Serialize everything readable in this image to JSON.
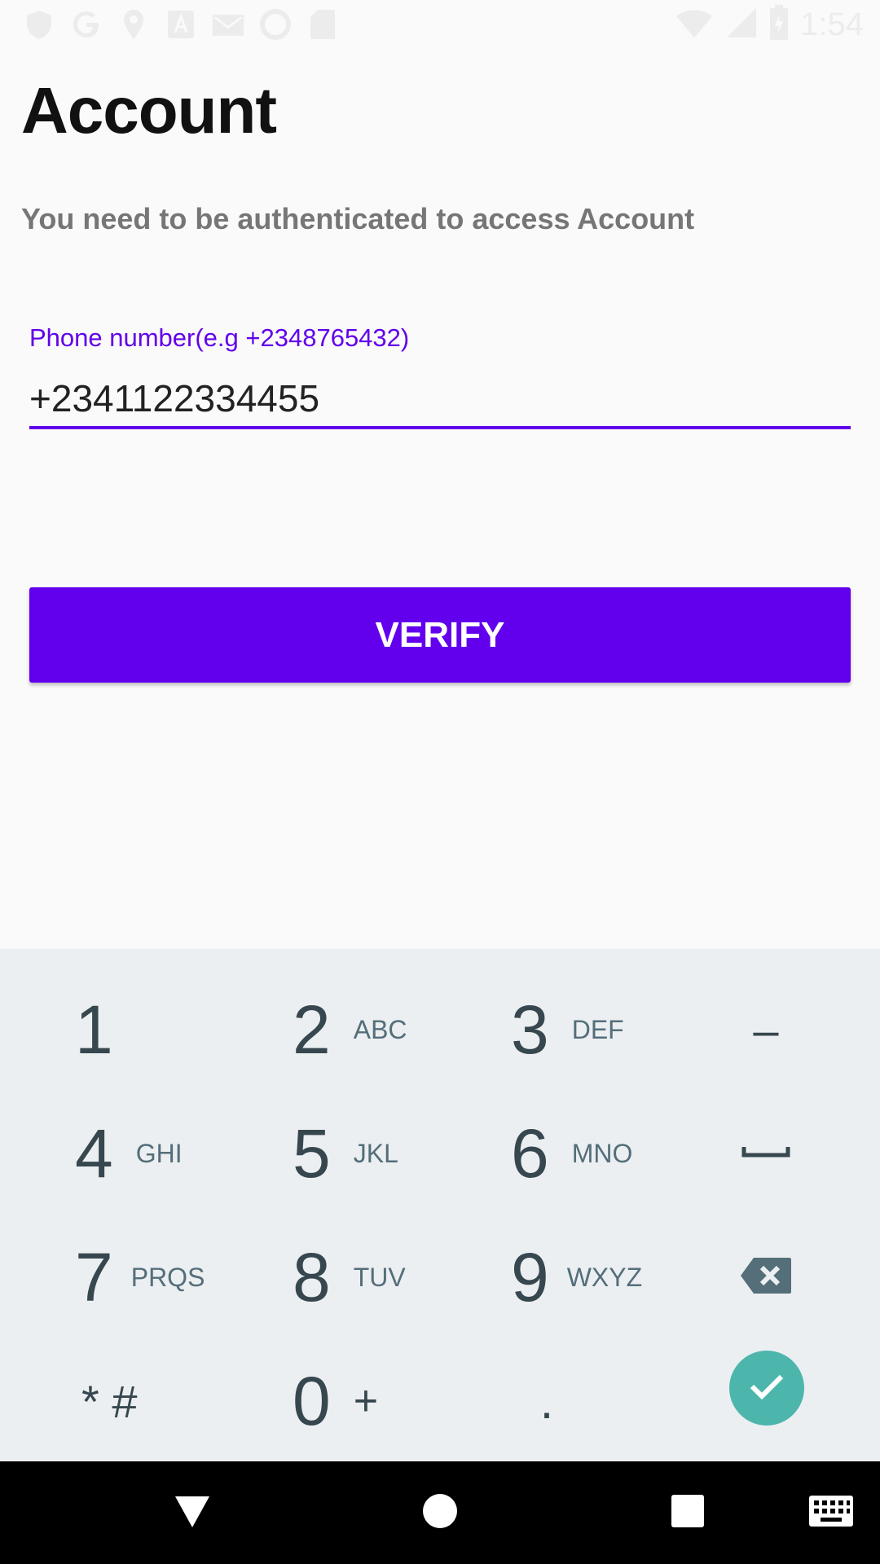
{
  "status_bar": {
    "time": "1:54",
    "left_icons": [
      "shield-icon",
      "google-icon",
      "location-icon",
      "a-icon",
      "mail-icon",
      "sync-icon",
      "sd-card-icon"
    ],
    "right_icons": [
      "wifi-icon",
      "signal-icon",
      "battery-icon"
    ]
  },
  "page": {
    "title": "Account",
    "subtitle": "You need to be authenticated to access Account"
  },
  "phone_field": {
    "label": "Phone number(e.g +2348765432)",
    "value": "+2341122334455"
  },
  "verify_button": {
    "label": "VERIFY"
  },
  "keyboard": {
    "keys": [
      {
        "digit": "1",
        "letters": ""
      },
      {
        "digit": "2",
        "letters": "ABC"
      },
      {
        "digit": "3",
        "letters": "DEF"
      },
      {
        "digit": "–",
        "letters": ""
      },
      {
        "digit": "4",
        "letters": "GHI"
      },
      {
        "digit": "5",
        "letters": "JKL"
      },
      {
        "digit": "6",
        "letters": "MNO"
      },
      {
        "digit": "␣",
        "letters": ""
      },
      {
        "digit": "7",
        "letters": "PRQS"
      },
      {
        "digit": "8",
        "letters": "TUV"
      },
      {
        "digit": "9",
        "letters": "WXYZ"
      },
      {
        "digit": "⌫",
        "letters": ""
      },
      {
        "digit": "* #",
        "letters": ""
      },
      {
        "digit": "0",
        "letters": "+"
      },
      {
        "digit": ".",
        "letters": ""
      }
    ],
    "check_icon": "check-icon",
    "accent": "#4db6ac"
  },
  "nav_bar": {
    "icons": [
      "back-icon",
      "home-icon",
      "recents-icon",
      "keyboard-icon"
    ]
  },
  "colors": {
    "primary": "#6200ee",
    "label": "#6200ea"
  }
}
